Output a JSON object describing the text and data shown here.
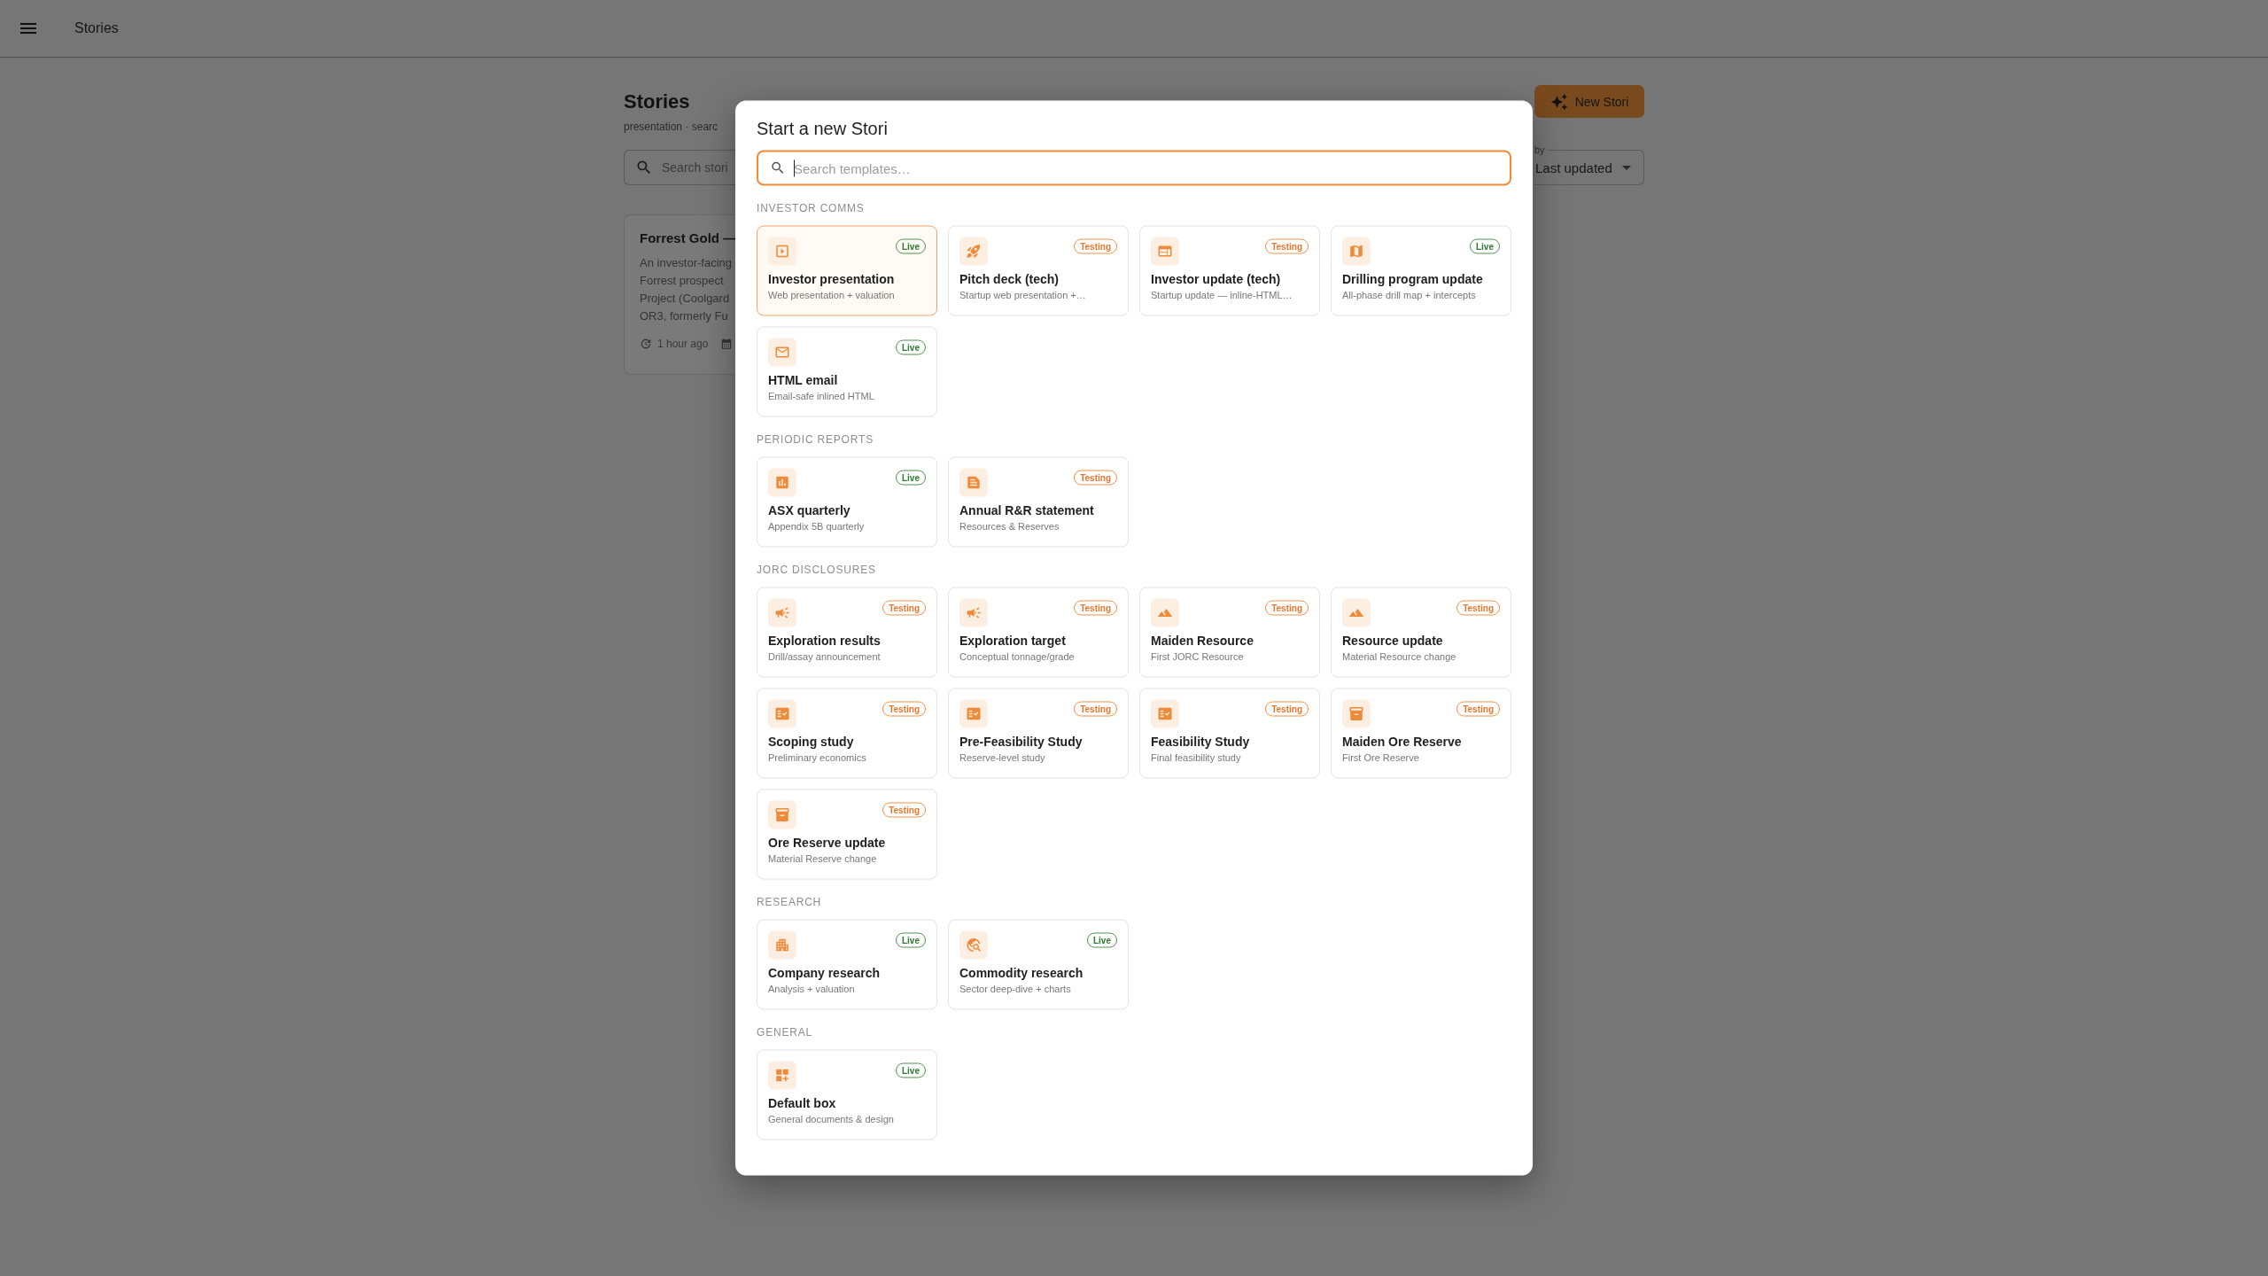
{
  "app_bar": {
    "title": "Stories"
  },
  "page": {
    "title": "Stories",
    "subtitle": "presentation · searc",
    "search": {
      "placeholder": "Search stori"
    },
    "new_button": {
      "label": "New Stori"
    },
    "sort": {
      "label": "by",
      "value": "Last updated"
    },
    "story_card": {
      "title": "Forrest Gold —",
      "description_lines": [
        "An investor-facing",
        "Forrest prospect",
        "Project (Coolgard",
        "OR3, formerly Fu"
      ],
      "updated": "1 hour ago"
    }
  },
  "dialog": {
    "title": "Start a new Stori",
    "search": {
      "placeholder": "Search templates…",
      "focused": true
    },
    "sections": [
      {
        "label": "INVESTOR COMMS",
        "templates": [
          {
            "kind": "presentation",
            "title": "Investor presentation",
            "description": "Web presentation + valuation",
            "badge": {
              "label": "Live",
              "kind": "live"
            },
            "selected": true
          },
          {
            "kind": "pitch",
            "title": "Pitch deck (tech)",
            "description": "Startup web presentation +…",
            "badge": {
              "label": "Testing",
              "kind": "testing"
            },
            "selected": false
          },
          {
            "kind": "update",
            "title": "Investor update (tech)",
            "description": "Startup update — inline-HTML…",
            "badge": {
              "label": "Testing",
              "kind": "testing"
            },
            "selected": false
          },
          {
            "kind": "drilling",
            "title": "Drilling program update",
            "description": "All-phase drill map + intercepts",
            "badge": {
              "label": "Live",
              "kind": "live"
            },
            "selected": false
          },
          {
            "kind": "email",
            "title": "HTML email",
            "description": "Email-safe inlined HTML",
            "badge": {
              "label": "Live",
              "kind": "live"
            },
            "selected": false
          }
        ]
      },
      {
        "label": "PERIODIC REPORTS",
        "templates": [
          {
            "kind": "quarterly",
            "title": "ASX quarterly",
            "description": "Appendix 5B quarterly",
            "badge": {
              "label": "Live",
              "kind": "live"
            },
            "selected": false
          },
          {
            "kind": "statement",
            "title": "Annual R&R statement",
            "description": "Resources & Reserves",
            "badge": {
              "label": "Testing",
              "kind": "testing"
            },
            "selected": false
          }
        ]
      },
      {
        "label": "JORC DISCLOSURES",
        "templates": [
          {
            "kind": "exploration",
            "title": "Exploration results",
            "description": "Drill/assay announcement",
            "badge": {
              "label": "Testing",
              "kind": "testing"
            },
            "selected": false
          },
          {
            "kind": "exploration",
            "title": "Exploration target",
            "description": "Conceptual tonnage/grade",
            "badge": {
              "label": "Testing",
              "kind": "testing"
            },
            "selected": false
          },
          {
            "kind": "resource",
            "title": "Maiden Resource",
            "description": "First JORC Resource",
            "badge": {
              "label": "Testing",
              "kind": "testing"
            },
            "selected": false
          },
          {
            "kind": "resource",
            "title": "Resource update",
            "description": "Material Resource change",
            "badge": {
              "label": "Testing",
              "kind": "testing"
            },
            "selected": false
          },
          {
            "kind": "study",
            "title": "Scoping study",
            "description": "Preliminary economics",
            "badge": {
              "label": "Testing",
              "kind": "testing"
            },
            "selected": false
          },
          {
            "kind": "study",
            "title": "Pre-Feasibility Study",
            "description": "Reserve-level study",
            "badge": {
              "label": "Testing",
              "kind": "testing"
            },
            "selected": false
          },
          {
            "kind": "study",
            "title": "Feasibility Study",
            "description": "Final feasibility study",
            "badge": {
              "label": "Testing",
              "kind": "testing"
            },
            "selected": false
          },
          {
            "kind": "reserve",
            "title": "Maiden Ore Reserve",
            "description": "First Ore Reserve",
            "badge": {
              "label": "Testing",
              "kind": "testing"
            },
            "selected": false
          },
          {
            "kind": "reserve",
            "title": "Ore Reserve update",
            "description": "Material Reserve change",
            "badge": {
              "label": "Testing",
              "kind": "testing"
            },
            "selected": false
          }
        ]
      },
      {
        "label": "RESEARCH",
        "templates": [
          {
            "kind": "company",
            "title": "Company research",
            "description": "Analysis + valuation",
            "badge": {
              "label": "Live",
              "kind": "live"
            },
            "selected": false
          },
          {
            "kind": "commodity",
            "title": "Commodity research",
            "description": "Sector deep-dive + charts",
            "badge": {
              "label": "Live",
              "kind": "live"
            },
            "selected": false
          }
        ]
      },
      {
        "label": "GENERAL",
        "templates": [
          {
            "kind": "general",
            "title": "Default box",
            "description": "General documents & design",
            "badge": {
              "label": "Live",
              "kind": "live"
            },
            "selected": false
          }
        ]
      }
    ]
  }
}
